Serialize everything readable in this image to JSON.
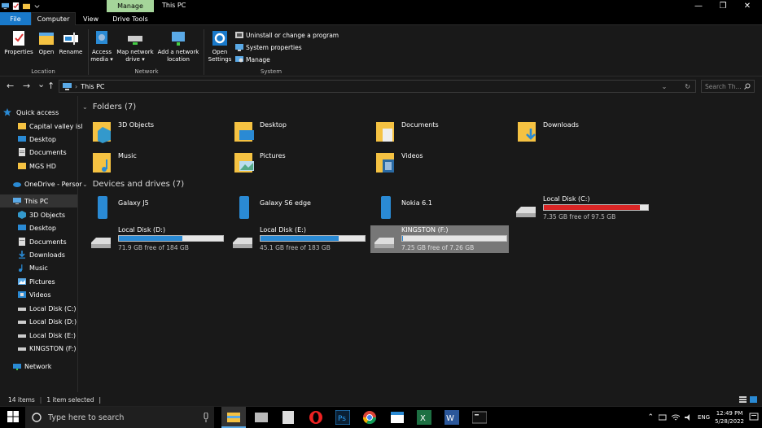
{
  "window": {
    "title": "This PC",
    "manage_tab": "Manage",
    "minimize": "—",
    "maximize": "❐",
    "close": "✕"
  },
  "ribbon_tabs": {
    "file": "File",
    "computer": "Computer",
    "view": "View",
    "drive_tools": "Drive Tools"
  },
  "ribbon": {
    "properties": "Properties",
    "open": "Open",
    "rename": "Rename",
    "access_media_1": "Access",
    "access_media_2": "media ▾",
    "map_drive_1": "Map network",
    "map_drive_2": "drive ▾",
    "add_location_1": "Add a network",
    "add_location_2": "location",
    "open_settings_1": "Open",
    "open_settings_2": "Settings",
    "uninstall": "Uninstall or change a program",
    "system_properties": "System properties",
    "manage": "Manage",
    "group_location": "Location",
    "group_network": "Network",
    "group_system": "System"
  },
  "address": {
    "path_sep": "›",
    "path": "This PC",
    "search_placeholder": "Search Th...",
    "back": "←",
    "forward": "→",
    "dropdown": "⌄",
    "up": "↑"
  },
  "nav": {
    "quick_access": "Quick access",
    "qa_items": [
      "Capital valley isl",
      "Desktop",
      "Documents",
      "MGS HD"
    ],
    "onedrive": "OneDrive - Persor",
    "this_pc": "This PC",
    "pc_items": [
      "3D Objects",
      "Desktop",
      "Documents",
      "Downloads",
      "Music",
      "Pictures",
      "Videos",
      "Local Disk (C:)",
      "Local Disk (D:)",
      "Local Disk (E:)",
      "KINGSTON (F:)"
    ],
    "network": "Network"
  },
  "folders_header": "Folders (7)",
  "folders": [
    "3D Objects",
    "Desktop",
    "Documents",
    "Downloads",
    "Music",
    "Pictures",
    "Videos"
  ],
  "devices_header": "Devices and drives (7)",
  "devices": [
    "Galaxy J5",
    "Galaxy S6 edge",
    "Nokia 6.1"
  ],
  "drives": [
    {
      "name": "Local Disk (C:)",
      "free": "7.35 GB free of 97.5 GB",
      "used_fraction": 0.925,
      "color": "#da2626"
    },
    {
      "name": "Local Disk (D:)",
      "free": "71.9 GB free of 184 GB",
      "used_fraction": 0.61,
      "color": "#2a8ad4"
    },
    {
      "name": "Local Disk (E:)",
      "free": "45.1 GB free of 183 GB",
      "used_fraction": 0.75,
      "color": "#2a8ad4"
    },
    {
      "name": "KINGSTON (F:)",
      "free": "7.25 GB free of 7.26 GB",
      "used_fraction": 0.002,
      "color": "#2a8ad4"
    }
  ],
  "status": {
    "items": "14 items",
    "selected": "1 item selected"
  },
  "taskbar": {
    "search_placeholder": "Type here to search",
    "lang": "ENG",
    "time": "12:49 PM",
    "date": "5/28/2022"
  },
  "colors": {
    "accent": "#1979ca",
    "manage": "#a5d59a",
    "folder": "#f5c242"
  }
}
